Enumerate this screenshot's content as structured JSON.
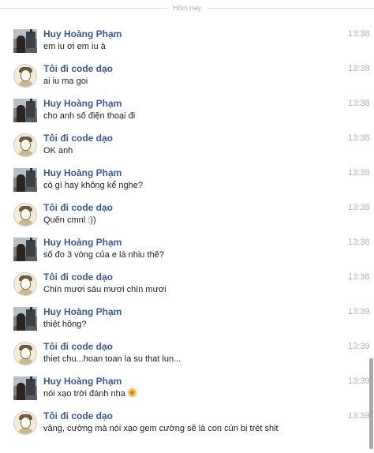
{
  "divider_label": "Hôm nay",
  "messages": [
    {
      "sender": "Huy Hoàng Phạm",
      "avatar": "photo-avatar",
      "text": "em iu ơi em iu à",
      "time": "13:38"
    },
    {
      "sender": "Tôi đi code dạo",
      "avatar": "cartoon-avatar",
      "text": "ai iu ma goi",
      "time": "13:38"
    },
    {
      "sender": "Huy Hoàng Phạm",
      "avatar": "photo-avatar",
      "text": "cho anh số điện thoại đi",
      "time": "13:38"
    },
    {
      "sender": "Tôi đi code dạo",
      "avatar": "cartoon-avatar",
      "text": "OK anh",
      "time": "13:38"
    },
    {
      "sender": "Huy Hoàng Phạm",
      "avatar": "photo-avatar",
      "text": "có gì hay không kể nghe?",
      "time": "13:38"
    },
    {
      "sender": "Tôi đi code dạo",
      "avatar": "cartoon-avatar",
      "text": "Quên cmnl :))",
      "time": "13:38"
    },
    {
      "sender": "Huy Hoàng Phạm",
      "avatar": "photo-avatar",
      "text": "số đo 3 vòng của e là nhiu thế?",
      "time": "13:38"
    },
    {
      "sender": "Tôi đi code dạo",
      "avatar": "cartoon-avatar",
      "text": "Chín mươi sáu mươi chín mươi",
      "time": "13:38"
    },
    {
      "sender": "Huy Hoàng Phạm",
      "avatar": "photo-avatar",
      "text": "thiệt hông?",
      "time": "13:39"
    },
    {
      "sender": "Tôi đi code dạo",
      "avatar": "cartoon-avatar",
      "text": "thiet chu...hoan toan la su that lun...",
      "time": "13:39"
    },
    {
      "sender": "Huy Hoàng Phạm",
      "avatar": "photo-avatar",
      "text": "nói xạo trời đánh nha",
      "emoji": "emoticon-icon",
      "time": "13:39"
    },
    {
      "sender": "Tôi đi code dạo",
      "avatar": "cartoon-avatar",
      "text": "vâng, cường mà nói xạo gem cường sẽ là con cún bị trét shit",
      "time": "13:39"
    }
  ]
}
